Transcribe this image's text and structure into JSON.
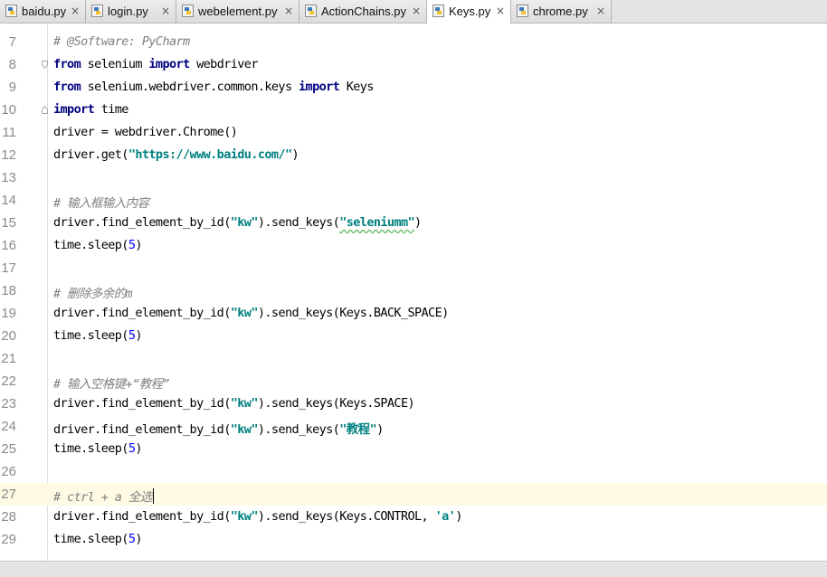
{
  "tabs": [
    {
      "label": "baidu.py",
      "active": false
    },
    {
      "label": "login.py",
      "active": false
    },
    {
      "label": "webelement.py",
      "active": false
    },
    {
      "label": "ActionChains.py",
      "active": false
    },
    {
      "label": "Keys.py",
      "active": true
    },
    {
      "label": "chrome.py",
      "active": false
    }
  ],
  "close_glyph": "×",
  "colors": {
    "keyword": "#000080",
    "comment": "#808080",
    "string": "#008080",
    "number": "#0000ff",
    "current_line": "#fffae3"
  },
  "editor": {
    "lines": [
      {
        "no": "7",
        "code": "# @Software: PyCharm"
      },
      {
        "no": "8",
        "kw1": "from",
        "mid": " selenium ",
        "kw2": "import",
        "rest": " webdriver"
      },
      {
        "no": "9",
        "kw1": "from",
        "mid": " selenium.webdriver.common.keys ",
        "kw2": "import",
        "rest": " Keys"
      },
      {
        "no": "10",
        "kw1": "import",
        "rest": " time"
      },
      {
        "no": "11",
        "code": "driver = webdriver.Chrome()"
      },
      {
        "no": "12",
        "pre": "driver.get(",
        "str": "\"https://www.baidu.com/\"",
        "post": ")"
      },
      {
        "no": "13"
      },
      {
        "no": "14",
        "code": "# 输入框输入内容"
      },
      {
        "no": "15",
        "pre": "driver.find_element_by_id(",
        "str": "\"kw\"",
        "mid": ").send_keys(",
        "str2": "\"seleniumm\"",
        "post": ")"
      },
      {
        "no": "16",
        "pre": "time.sleep(",
        "num": "5",
        "post": ")"
      },
      {
        "no": "17"
      },
      {
        "no": "18",
        "code": "# 删除多余的m"
      },
      {
        "no": "19",
        "pre": "driver.find_element_by_id(",
        "str": "\"kw\"",
        "post": ").send_keys(Keys.BACK_SPACE)"
      },
      {
        "no": "20",
        "pre": "time.sleep(",
        "num": "5",
        "post": ")"
      },
      {
        "no": "21"
      },
      {
        "no": "22",
        "code": "# 输入空格键+“教程”"
      },
      {
        "no": "23",
        "pre": "driver.find_element_by_id(",
        "str": "\"kw\"",
        "post": ").send_keys(Keys.SPACE)"
      },
      {
        "no": "24",
        "pre": "driver.find_element_by_id(",
        "str": "\"kw\"",
        "mid": ").send_keys(",
        "str2": "\"教程\"",
        "post": ")"
      },
      {
        "no": "25",
        "pre": "time.sleep(",
        "num": "5",
        "post": ")"
      },
      {
        "no": "26"
      },
      {
        "no": "27",
        "code": "# ctrl + a 全选"
      },
      {
        "no": "28",
        "pre": "driver.find_element_by_id(",
        "str": "\"kw\"",
        "mid": ").send_keys(Keys.CONTROL, ",
        "str2": "'a'",
        "post": ")"
      },
      {
        "no": "29",
        "pre": "time.sleep(",
        "num": "5",
        "post": ")"
      }
    ]
  }
}
